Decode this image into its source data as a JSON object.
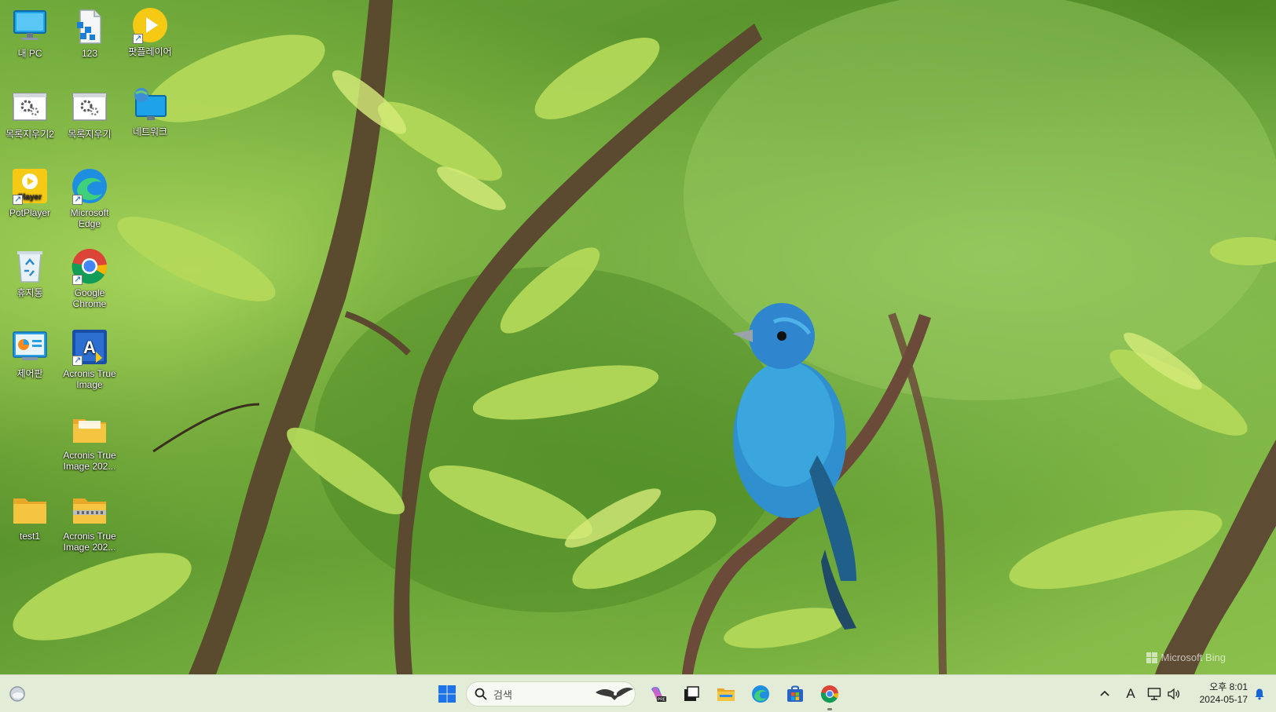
{
  "desktop": {
    "icons": [
      {
        "label": "내 PC",
        "icon": "this-pc-icon"
      },
      {
        "label": "123",
        "icon": "document-icon"
      },
      {
        "label": "팟플레이어",
        "icon": "potplayer-icon"
      },
      {
        "label": "목록지우기2",
        "icon": "settings-script-icon"
      },
      {
        "label": "목록지우기",
        "icon": "settings-script-icon"
      },
      {
        "label": "네트워크",
        "icon": "network-icon"
      },
      {
        "label": "PotPlayer",
        "icon": "potplayer-app-icon",
        "badge": "Player"
      },
      {
        "label": "Microsoft Edge",
        "icon": "edge-icon"
      },
      {
        "label": "휴지통",
        "icon": "recycle-bin-icon"
      },
      {
        "label": "Google Chrome",
        "icon": "chrome-icon"
      },
      {
        "label": "제어판",
        "icon": "control-panel-icon"
      },
      {
        "label": "Acronis True Image",
        "icon": "acronis-icon",
        "badge": "A"
      },
      {
        "label": "Acronis True Image 202...",
        "icon": "folder-icon"
      },
      {
        "label": "test1",
        "icon": "folder-icon"
      },
      {
        "label": "Acronis True Image 202...",
        "icon": "zip-folder-icon"
      }
    ],
    "watermark": "Microsoft Bing"
  },
  "taskbar": {
    "search_placeholder": "검색",
    "apps": [
      "weather-widget-icon",
      "start-icon",
      "copilot-icon",
      "task-view-icon",
      "file-explorer-icon",
      "edge-icon",
      "store-icon",
      "chrome-icon"
    ],
    "tray": {
      "ime": "A",
      "time": "오후 8:01",
      "date": "2024-05-17"
    }
  },
  "colors": {
    "taskbar_bg": "#e3ecd6",
    "start_blue": "#1e73e8",
    "folder_yellow": "#f5c542"
  }
}
